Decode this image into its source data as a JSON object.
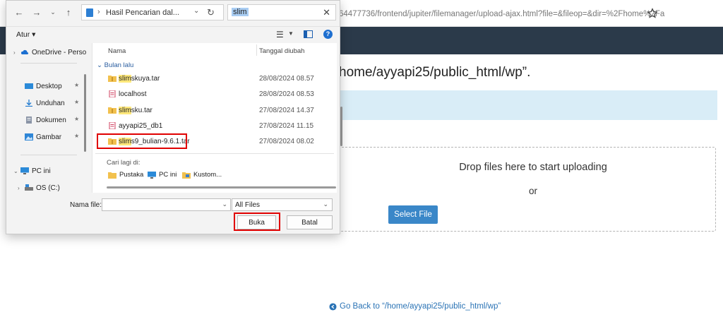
{
  "browser": {
    "url": "64477736/frontend/jupiter/filemanager/upload-ajax.html?file=&fileop=&dir=%2Fhome%2Fa"
  },
  "upload_page": {
    "title": "home/ayyapi25/public_html/wp”.",
    "drop_text": "Drop files here to start uploading",
    "or_text": "or",
    "select_file_label": "Select File",
    "go_back_label": "Go Back to “/home/ayyapi25/public_html/wp”"
  },
  "dialog": {
    "path_text": "Hasil Pencarian dal...",
    "search_value": "slim",
    "organize_label": "Atur ▾",
    "nav": {
      "onedrive": "OneDrive - Perso",
      "desktop": "Desktop",
      "downloads": "Unduhan",
      "documents": "Dokumen",
      "pictures": "Gambar",
      "this_pc": "PC ini",
      "os_drive": "OS (C:)"
    },
    "columns": {
      "name": "Nama",
      "date": "Tanggal diubah"
    },
    "group_label": "Bulan lalu",
    "files": [
      {
        "highlight": "slim",
        "rest": "skuya.tar",
        "date": "28/08/2024 08.57",
        "icon": "archive-icon"
      },
      {
        "highlight": "",
        "rest": "localhost",
        "date": "28/08/2024 08.53",
        "icon": "sql-file-icon"
      },
      {
        "highlight": "slim",
        "rest": "sku.tar",
        "date": "27/08/2024 14.37",
        "icon": "archive-icon"
      },
      {
        "highlight": "",
        "rest": "ayyapi25_db1",
        "date": "27/08/2024 11.15",
        "icon": "sql-file-icon"
      },
      {
        "highlight": "slim",
        "rest": "s9_bulian-9.6.1.tar",
        "date": "27/08/2024 08.02",
        "icon": "archive-icon"
      }
    ],
    "search_again_label": "Cari lagi di:",
    "search_again": [
      "Pustaka",
      "PC ini",
      "Kustom..."
    ],
    "filename_label": "Nama file:",
    "filename_value": "",
    "filetype_value": "All Files",
    "open_label": "Buka",
    "cancel_label": "Batal"
  },
  "colors": {
    "accent": "#3a87c8",
    "highlight_box": "#e00000",
    "dark_header": "#2b3a4a",
    "info_banner": "#d9edf7"
  }
}
